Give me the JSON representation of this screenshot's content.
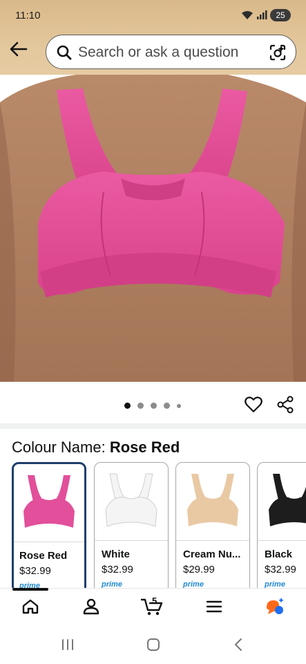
{
  "status_bar": {
    "time": "11:10",
    "battery": "25"
  },
  "search": {
    "placeholder": "Search or ask a question"
  },
  "product_image": {
    "alt": "Rose red sports bra",
    "color": "#e54c96"
  },
  "carousel": {
    "dot_count": 5,
    "active_index": 0
  },
  "colour": {
    "label": "Colour Name: ",
    "value": "Rose Red"
  },
  "swatches": [
    {
      "name": "Rose Red",
      "price": "$32.99",
      "prime": "prime",
      "color": "#e24f9a",
      "selected": true
    },
    {
      "name": "White",
      "price": "$32.99",
      "prime": "prime",
      "color": "#f4f4f4",
      "selected": false
    },
    {
      "name": "Cream Nu...",
      "price": "$29.99",
      "prime": "prime",
      "color": "#e9c9a4",
      "selected": false
    },
    {
      "name": "Black",
      "price": "$32.99",
      "prime": "prime",
      "color": "#1d1d1d",
      "selected": false
    }
  ],
  "bottom_nav": {
    "cart_count": "5",
    "rufus_colors": [
      "#ff6a1a",
      "#1f6ef2"
    ]
  }
}
